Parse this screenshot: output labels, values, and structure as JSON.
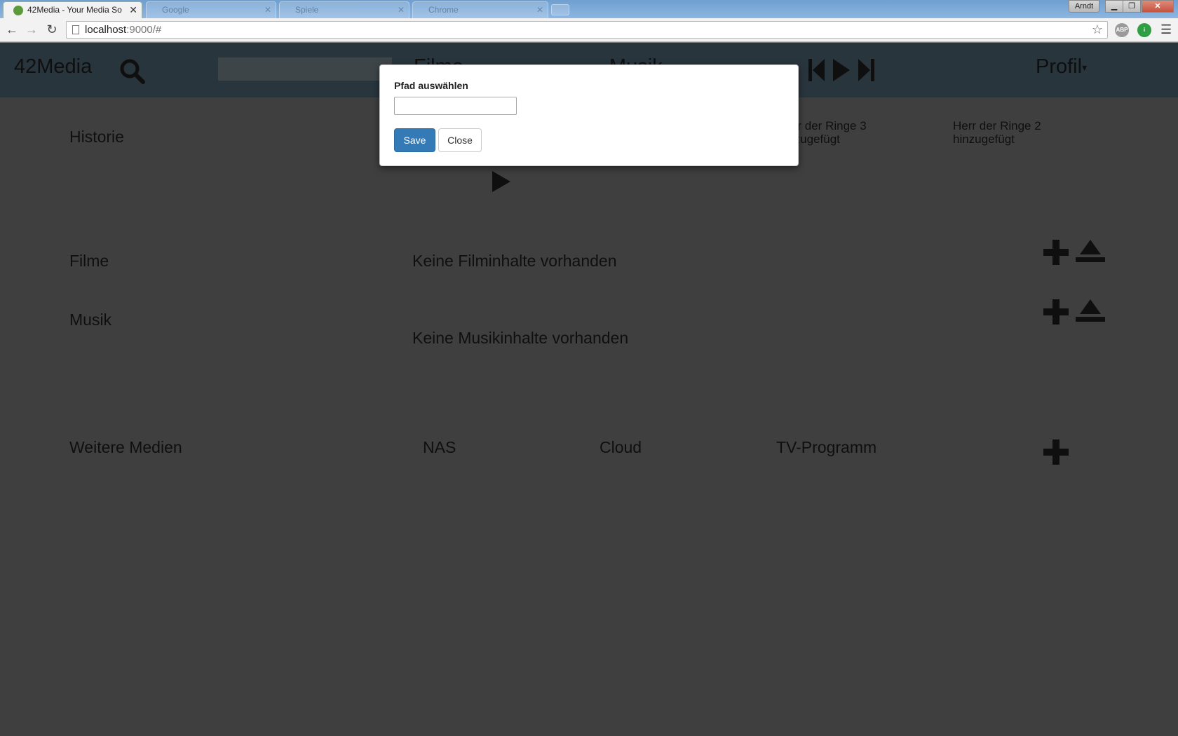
{
  "browser": {
    "active_tab": {
      "title": "42Media - Your Media So"
    },
    "inactive_tabs": [
      "Google",
      "Spiele",
      "Chrome"
    ],
    "profile_name": "Arndt",
    "url_host": "localhost",
    "url_rest": ":9000/#",
    "window_buttons": {
      "minimize": "▁",
      "maximize": "❐",
      "close": "✕"
    }
  },
  "header": {
    "brand": "42Media",
    "nav_filme": "Filme",
    "nav_musik": "Musik",
    "profile": "Profil",
    "profile_caret": "▾"
  },
  "sections": {
    "historie": "Historie",
    "history_items": [
      {
        "line1": "Herr der Ringe 3",
        "line2": "hinzugefügt"
      },
      {
        "line1": "Herr der Ringe 2",
        "line2": "hinzugefügt"
      }
    ],
    "filme": "Filme",
    "filme_empty": "Keine Filminhalte vorhanden",
    "musik": "Musik",
    "musik_empty": "Keine Musikinhalte vorhanden",
    "weitere": "Weitere Medien",
    "nas": "NAS",
    "cloud": "Cloud",
    "tv": "TV-Programm"
  },
  "modal": {
    "label": "Pfad auswählen",
    "input_value": "",
    "save": "Save",
    "close": "Close"
  },
  "colors": {
    "header_bg": "#526a7b",
    "page_bg": "#7f7f7f",
    "primary": "#337ab7"
  }
}
